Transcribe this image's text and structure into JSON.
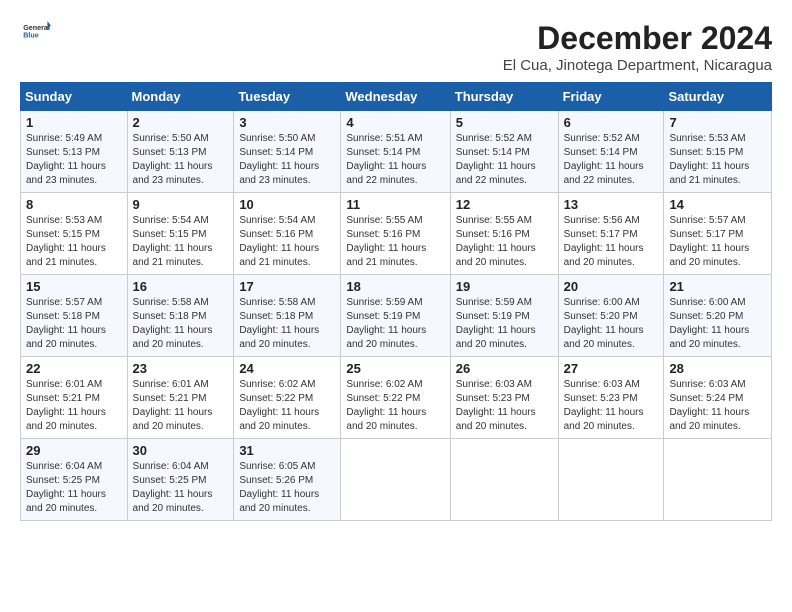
{
  "header": {
    "logo_general": "General",
    "logo_blue": "Blue",
    "month_title": "December 2024",
    "location": "El Cua, Jinotega Department, Nicaragua"
  },
  "weekdays": [
    "Sunday",
    "Monday",
    "Tuesday",
    "Wednesday",
    "Thursday",
    "Friday",
    "Saturday"
  ],
  "weeks": [
    [
      {
        "day": "1",
        "sunrise": "Sunrise: 5:49 AM",
        "sunset": "Sunset: 5:13 PM",
        "daylight": "Daylight: 11 hours and 23 minutes."
      },
      {
        "day": "2",
        "sunrise": "Sunrise: 5:50 AM",
        "sunset": "Sunset: 5:13 PM",
        "daylight": "Daylight: 11 hours and 23 minutes."
      },
      {
        "day": "3",
        "sunrise": "Sunrise: 5:50 AM",
        "sunset": "Sunset: 5:14 PM",
        "daylight": "Daylight: 11 hours and 23 minutes."
      },
      {
        "day": "4",
        "sunrise": "Sunrise: 5:51 AM",
        "sunset": "Sunset: 5:14 PM",
        "daylight": "Daylight: 11 hours and 22 minutes."
      },
      {
        "day": "5",
        "sunrise": "Sunrise: 5:52 AM",
        "sunset": "Sunset: 5:14 PM",
        "daylight": "Daylight: 11 hours and 22 minutes."
      },
      {
        "day": "6",
        "sunrise": "Sunrise: 5:52 AM",
        "sunset": "Sunset: 5:14 PM",
        "daylight": "Daylight: 11 hours and 22 minutes."
      },
      {
        "day": "7",
        "sunrise": "Sunrise: 5:53 AM",
        "sunset": "Sunset: 5:15 PM",
        "daylight": "Daylight: 11 hours and 21 minutes."
      }
    ],
    [
      {
        "day": "8",
        "sunrise": "Sunrise: 5:53 AM",
        "sunset": "Sunset: 5:15 PM",
        "daylight": "Daylight: 11 hours and 21 minutes."
      },
      {
        "day": "9",
        "sunrise": "Sunrise: 5:54 AM",
        "sunset": "Sunset: 5:15 PM",
        "daylight": "Daylight: 11 hours and 21 minutes."
      },
      {
        "day": "10",
        "sunrise": "Sunrise: 5:54 AM",
        "sunset": "Sunset: 5:16 PM",
        "daylight": "Daylight: 11 hours and 21 minutes."
      },
      {
        "day": "11",
        "sunrise": "Sunrise: 5:55 AM",
        "sunset": "Sunset: 5:16 PM",
        "daylight": "Daylight: 11 hours and 21 minutes."
      },
      {
        "day": "12",
        "sunrise": "Sunrise: 5:55 AM",
        "sunset": "Sunset: 5:16 PM",
        "daylight": "Daylight: 11 hours and 20 minutes."
      },
      {
        "day": "13",
        "sunrise": "Sunrise: 5:56 AM",
        "sunset": "Sunset: 5:17 PM",
        "daylight": "Daylight: 11 hours and 20 minutes."
      },
      {
        "day": "14",
        "sunrise": "Sunrise: 5:57 AM",
        "sunset": "Sunset: 5:17 PM",
        "daylight": "Daylight: 11 hours and 20 minutes."
      }
    ],
    [
      {
        "day": "15",
        "sunrise": "Sunrise: 5:57 AM",
        "sunset": "Sunset: 5:18 PM",
        "daylight": "Daylight: 11 hours and 20 minutes."
      },
      {
        "day": "16",
        "sunrise": "Sunrise: 5:58 AM",
        "sunset": "Sunset: 5:18 PM",
        "daylight": "Daylight: 11 hours and 20 minutes."
      },
      {
        "day": "17",
        "sunrise": "Sunrise: 5:58 AM",
        "sunset": "Sunset: 5:18 PM",
        "daylight": "Daylight: 11 hours and 20 minutes."
      },
      {
        "day": "18",
        "sunrise": "Sunrise: 5:59 AM",
        "sunset": "Sunset: 5:19 PM",
        "daylight": "Daylight: 11 hours and 20 minutes."
      },
      {
        "day": "19",
        "sunrise": "Sunrise: 5:59 AM",
        "sunset": "Sunset: 5:19 PM",
        "daylight": "Daylight: 11 hours and 20 minutes."
      },
      {
        "day": "20",
        "sunrise": "Sunrise: 6:00 AM",
        "sunset": "Sunset: 5:20 PM",
        "daylight": "Daylight: 11 hours and 20 minutes."
      },
      {
        "day": "21",
        "sunrise": "Sunrise: 6:00 AM",
        "sunset": "Sunset: 5:20 PM",
        "daylight": "Daylight: 11 hours and 20 minutes."
      }
    ],
    [
      {
        "day": "22",
        "sunrise": "Sunrise: 6:01 AM",
        "sunset": "Sunset: 5:21 PM",
        "daylight": "Daylight: 11 hours and 20 minutes."
      },
      {
        "day": "23",
        "sunrise": "Sunrise: 6:01 AM",
        "sunset": "Sunset: 5:21 PM",
        "daylight": "Daylight: 11 hours and 20 minutes."
      },
      {
        "day": "24",
        "sunrise": "Sunrise: 6:02 AM",
        "sunset": "Sunset: 5:22 PM",
        "daylight": "Daylight: 11 hours and 20 minutes."
      },
      {
        "day": "25",
        "sunrise": "Sunrise: 6:02 AM",
        "sunset": "Sunset: 5:22 PM",
        "daylight": "Daylight: 11 hours and 20 minutes."
      },
      {
        "day": "26",
        "sunrise": "Sunrise: 6:03 AM",
        "sunset": "Sunset: 5:23 PM",
        "daylight": "Daylight: 11 hours and 20 minutes."
      },
      {
        "day": "27",
        "sunrise": "Sunrise: 6:03 AM",
        "sunset": "Sunset: 5:23 PM",
        "daylight": "Daylight: 11 hours and 20 minutes."
      },
      {
        "day": "28",
        "sunrise": "Sunrise: 6:03 AM",
        "sunset": "Sunset: 5:24 PM",
        "daylight": "Daylight: 11 hours and 20 minutes."
      }
    ],
    [
      {
        "day": "29",
        "sunrise": "Sunrise: 6:04 AM",
        "sunset": "Sunset: 5:25 PM",
        "daylight": "Daylight: 11 hours and 20 minutes."
      },
      {
        "day": "30",
        "sunrise": "Sunrise: 6:04 AM",
        "sunset": "Sunset: 5:25 PM",
        "daylight": "Daylight: 11 hours and 20 minutes."
      },
      {
        "day": "31",
        "sunrise": "Sunrise: 6:05 AM",
        "sunset": "Sunset: 5:26 PM",
        "daylight": "Daylight: 11 hours and 20 minutes."
      },
      null,
      null,
      null,
      null
    ]
  ]
}
